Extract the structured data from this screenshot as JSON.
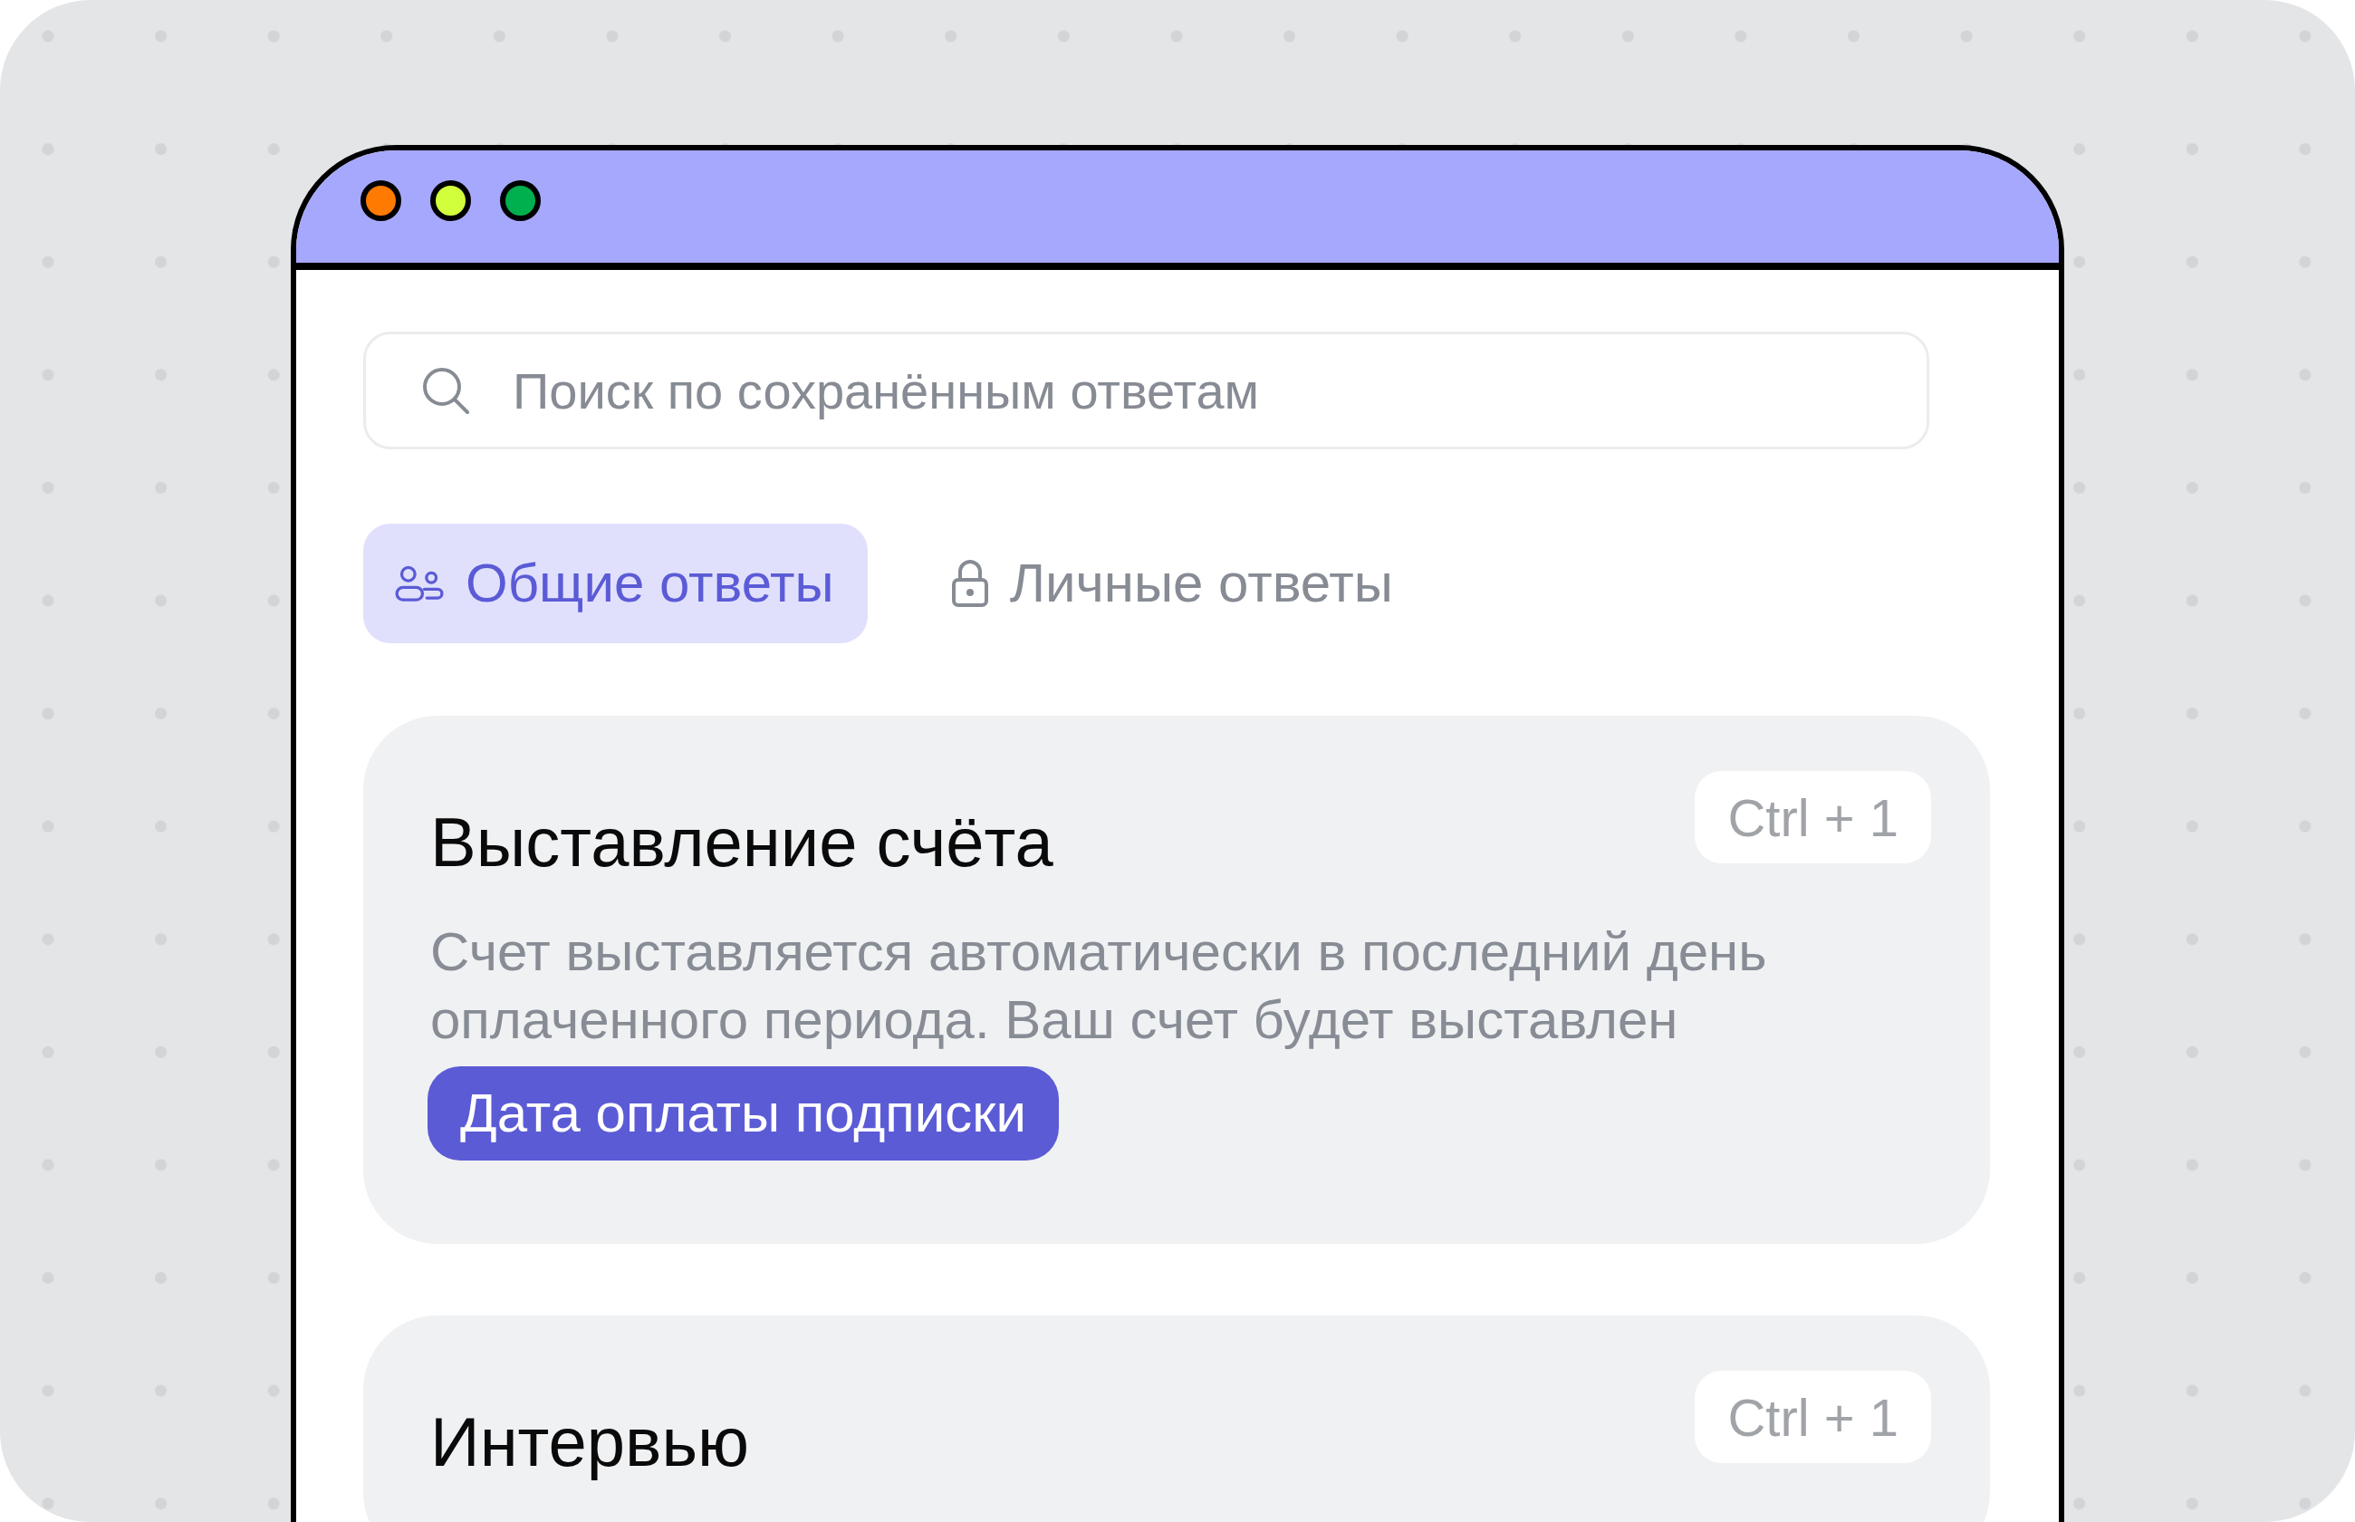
{
  "window_controls": [
    {
      "color": "#ff7a00"
    },
    {
      "color": "#d2ff3c"
    },
    {
      "color": "#00b04f"
    }
  ],
  "search": {
    "placeholder": "Поиск по сохранённым ответам"
  },
  "tabs": [
    {
      "kind": "shared",
      "label": "Общие ответы",
      "selected": true
    },
    {
      "kind": "private",
      "label": "Личные ответы",
      "selected": false
    }
  ],
  "answers": [
    {
      "title": "Выставление счёта",
      "shortcut": "Ctrl + 1",
      "body": "Счет выставляется автоматически в последний день оплаченного периода. Ваш счет будет выставлен",
      "variables": [
        "Дата оплаты подписки"
      ]
    },
    {
      "title": "Интервью",
      "shortcut": "Ctrl + 1"
    }
  ]
}
